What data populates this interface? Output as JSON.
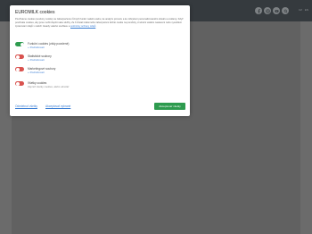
{
  "header": {
    "icons": [
      "facebook-icon",
      "instagram-icon",
      "youtube-icon",
      "search-icon"
    ],
    "links": [
      "CZ",
      "EN"
    ]
  },
  "cookies": {
    "title": "EUROMILK cookies",
    "description": "Používáme cookies (soubory cookie) na zabezpečenie různých funkcí našeho webu, ke analýzu provozu a ke zobrazení personalizovaného obsahu a reklamy. Když používáte cookies, aby jsme mohli zlepšit naše služby. Ze fi zůstali zákonného zabezpečení těchto cookie na pomůcky, změnění vašeho nastavení nebo vysvětlení zpracování údajů v našich zásady vašeho souhlasu a",
    "description_link": "podmínky ochrany údajů",
    "categories": [
      {
        "label": "Funkční cookies (vždy povolené)",
        "detail": "+ Podrobnosti",
        "state": "on"
      },
      {
        "label": "Statistické soubory",
        "detail": "+ Podrobnosti",
        "state": "off"
      },
      {
        "label": "Marketingové soubory",
        "detail": "+ Podrobnosti",
        "state": "off"
      },
      {
        "label": "Všetky cookies",
        "note": "Zapnúť všetky cookies, alebo odvolať",
        "state": "off"
      }
    ],
    "reject_label": "Odmietnuť všetky",
    "accept_selected_label": "Akceptovať vybrané",
    "accept_all_label": "Akceptovať všetky"
  }
}
